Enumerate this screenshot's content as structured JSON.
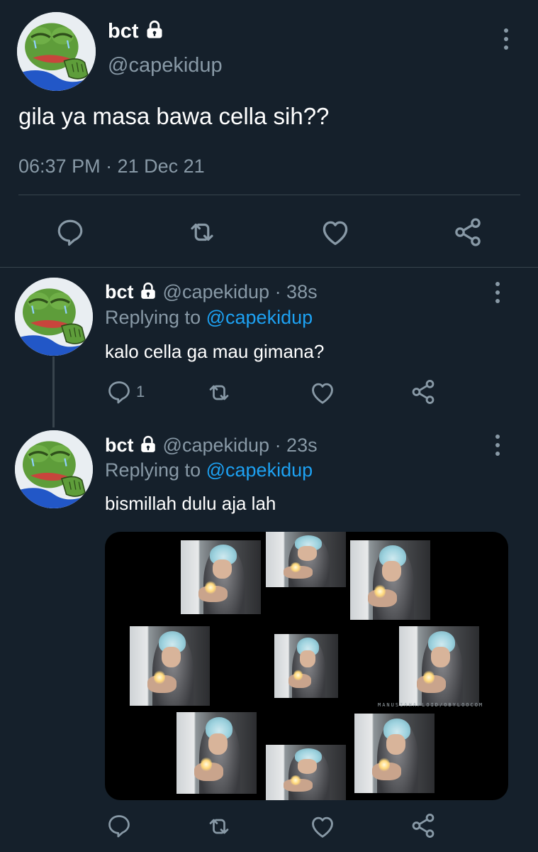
{
  "main_tweet": {
    "display_name": "bct",
    "handle": "@capekidup",
    "text": "gila ya masa bawa cella sih??",
    "timestamp": "06:37 PM · 21 Dec 21",
    "icons": [
      "lock-icon",
      "more-icon",
      "reply-icon",
      "retweet-icon",
      "like-icon",
      "share-icon"
    ]
  },
  "replies": [
    {
      "display_name": "bct",
      "handle": "@capekidup",
      "time": "· 38s",
      "replying_prefix": "Replying to",
      "replying_to": "@capekidup",
      "text": "kalo cella ga mau gimana?",
      "reply_count": "1"
    },
    {
      "display_name": "bct",
      "handle": "@capekidup",
      "time": "· 23s",
      "replying_prefix": "Replying to",
      "replying_to": "@capekidup",
      "text": "bismillah dulu aja lah",
      "media_watermark": "MANUSIAHAPLOID/OBYLOOCOM"
    }
  ],
  "colors": {
    "background": "#15202b",
    "muted": "#8899a6",
    "link": "#1da1f2",
    "divider": "#38444d"
  }
}
